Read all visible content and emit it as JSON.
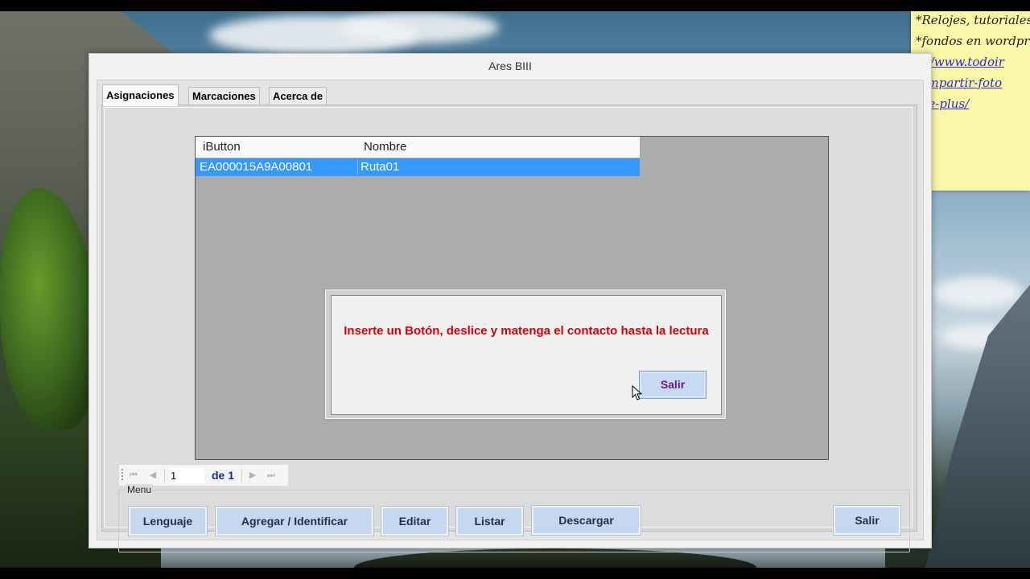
{
  "sticky_note": {
    "lines": [
      "*Relojes, tutoriales.",
      "*fondos en wordpr"
    ],
    "links": [
      "tp://www.todoir",
      "-compartir-foto",
      "ogle-plus/"
    ]
  },
  "window": {
    "title": "Ares BIII"
  },
  "tabs": [
    {
      "label": "Asignaciones",
      "active": true
    },
    {
      "label": "Marcaciones",
      "active": false
    },
    {
      "label": "Acerca de",
      "active": false
    }
  ],
  "grid": {
    "columns": [
      "iButton",
      "Nombre"
    ],
    "rows": [
      {
        "ibutton": "EA000015A9A00801",
        "nombre": "Ruta01",
        "selected": true
      }
    ]
  },
  "navigator": {
    "current_page": "1",
    "of_label": "de 1",
    "icons": [
      "first-page-icon",
      "previous-page-icon",
      "next-page-icon",
      "last-page-icon"
    ]
  },
  "menu": {
    "legend": "Menu",
    "buttons": {
      "lenguaje": "Lenguaje",
      "agregar": "Agregar / Identificar",
      "editar": "Editar",
      "listar": "Listar",
      "descargar": "Descargar",
      "salir": "Salir"
    }
  },
  "dialog": {
    "message": "Inserte un Botón, deslice y matenga el contacto hasta la lectura",
    "button": "Salir",
    "message_color": "#d4000a"
  },
  "colors": {
    "selection": "#3399ff",
    "button_face": "#c6d8ef",
    "sticky": "#fbf7a9"
  }
}
